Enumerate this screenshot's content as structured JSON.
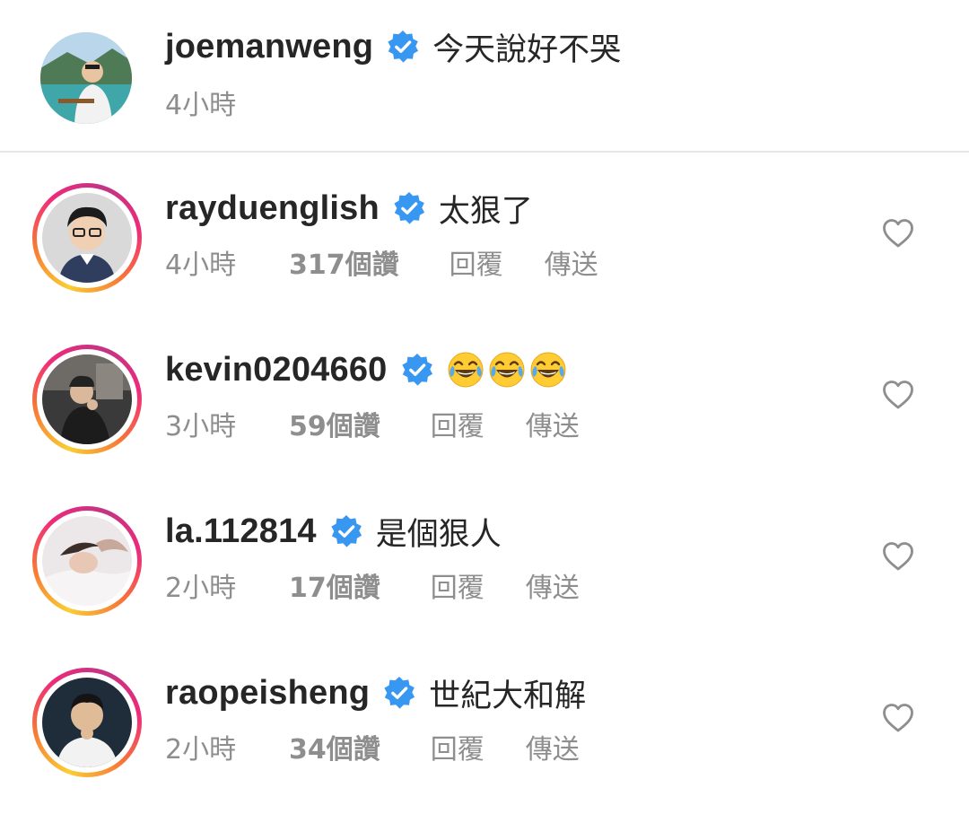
{
  "post": {
    "username": "joemanweng",
    "caption": "今天說好不哭",
    "time": "4小時"
  },
  "comments": [
    {
      "username": "rayduenglish",
      "text": "太狠了",
      "time": "4小時",
      "likes": "317個讚",
      "reply": "回覆",
      "send": "傳送"
    },
    {
      "username": "kevin0204660",
      "text": "",
      "emoji": "face-with-tears-of-joy",
      "emoji_count": 3,
      "time": "3小時",
      "likes": "59個讚",
      "reply": "回覆",
      "send": "傳送"
    },
    {
      "username": "la.112814",
      "text": "是個狠人",
      "time": "2小時",
      "likes": "17個讚",
      "reply": "回覆",
      "send": "傳送"
    },
    {
      "username": "raopeisheng",
      "text": "世紀大和解",
      "time": "2小時",
      "likes": "34個讚",
      "reply": "回覆",
      "send": "傳送"
    }
  ],
  "colors": {
    "verified": "#3897f0",
    "text": "#262626",
    "meta": "#8e8e8e",
    "divider": "#e6e6e6"
  },
  "icons": {
    "verified": "verified-badge-icon",
    "like": "heart-outline-icon"
  }
}
